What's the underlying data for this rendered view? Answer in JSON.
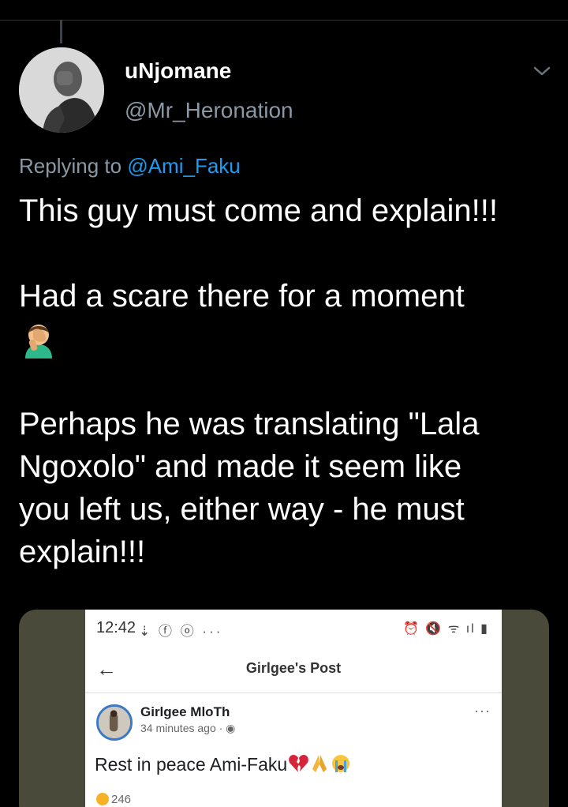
{
  "tweet": {
    "display_name": "uNjomane",
    "handle": "@Mr_Heronation",
    "replying_prefix": "Replying to",
    "replying_mention": "@Ami_Faku",
    "line1": "This guy must come and explain!!!",
    "line2": "Had a scare there for a moment",
    "line3_a": "Perhaps he was translating \"Lala",
    "line3_b": "Ngoxolo\" and made it seem like",
    "line3_c": "you left us, either way - he must",
    "line3_d": "explain!!!",
    "icons": [
      "chevron-down-icon",
      "facepalm-emoji"
    ]
  },
  "screenshot": {
    "status_time": "12:42",
    "status_icons_left": "⇣ ⓕ ⓞ ···",
    "status_icons_right": "⏰ 🔇 ᯤ ıl ▮",
    "header_title": "Girlgee's Post",
    "back_icon": "←",
    "author": "Girlgee MloTh",
    "meta": "34 minutes ago · ◉",
    "more": "···",
    "post_text": "Rest in peace Ami-Faku",
    "reaction_count": "246"
  },
  "colors": {
    "background": "#000000",
    "text": "#ffffff",
    "muted": "#8b98a5",
    "link": "#1d9bf0"
  }
}
